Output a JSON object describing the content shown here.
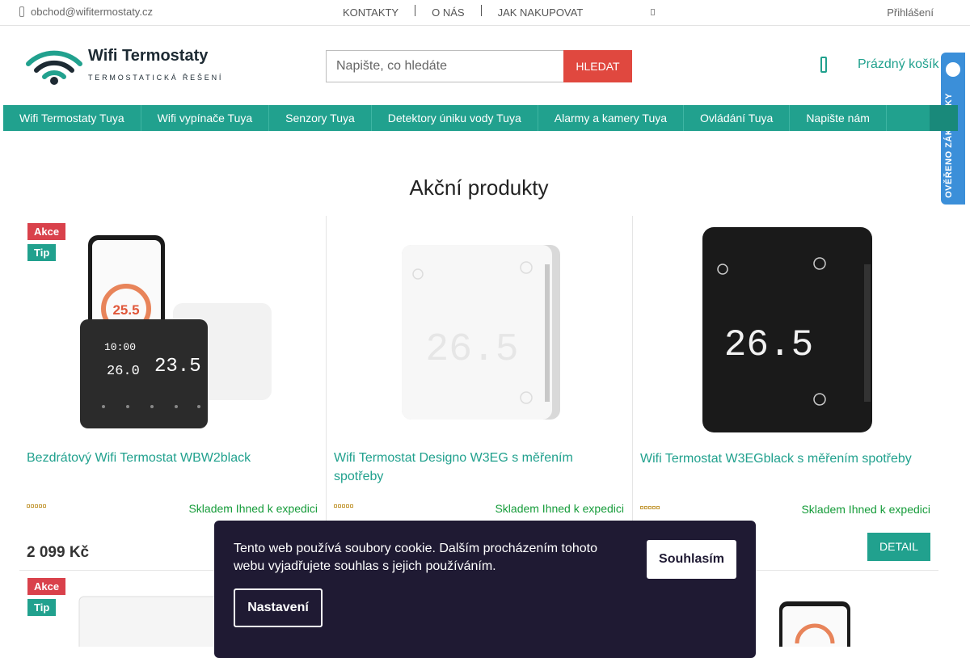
{
  "topbar": {
    "email": "obchod@wifitermostaty.cz",
    "links": [
      "KONTAKTY",
      "O NÁS",
      "JAK NAKUPOVAT"
    ],
    "login": "Přihlášení"
  },
  "logo": {
    "name": "Wifi Termostaty",
    "tagline": "TERMOSTATICKÁ ŘEŠENÍ"
  },
  "search": {
    "placeholder": "Napište, co hledáte",
    "button": "HLEDAT"
  },
  "cart": {
    "label": "Prázdný košík"
  },
  "nav": {
    "items": [
      "Wifi Termostaty Tuya",
      "Wifi vypínače Tuya",
      "Senzory Tuya",
      "Detektory úniku vody Tuya",
      "Alarmy a kamery Tuya",
      "Ovládání Tuya",
      "Napište nám"
    ]
  },
  "side_badge": {
    "text": "OVĚŘENO ZÁKAZNÍKY"
  },
  "section": {
    "title": "Akční produkty"
  },
  "products": [
    {
      "name": "Bezdrátový Wifi Termostat WBW2black",
      "stock": "Skladem Ihned k expedici",
      "price": "2 099 Kč",
      "flags": [
        "Akce",
        "Tip"
      ],
      "rating": 0
    },
    {
      "name": "Wifi Termostat Designo W3EG s měřením spotřeby",
      "stock": "Skladem Ihned k expedici",
      "flags": [],
      "rating": 0
    },
    {
      "name": "Wifi Termostat W3EGblack s měřením spotřeby",
      "stock": "Skladem Ihned k expedici",
      "detail": "DETAIL",
      "flags": [],
      "rating": 0
    }
  ],
  "products_row2": [
    {
      "flags": [
        "Akce",
        "Tip"
      ]
    }
  ],
  "screen_texts": {
    "p1_display_time": "10:00",
    "p1_display_temp": "26.0",
    "p1_display_room": "23.5",
    "p1_phone_temp": "25.5",
    "p2_display": "26.5",
    "p3_display": "26.5"
  },
  "cookie": {
    "text": "Tento web používá soubory cookie. Dalším procházením tohoto webu vyjadřujete souhlas s jejich používáním.",
    "accept": "Souhlasím",
    "settings": "Nastavení"
  },
  "colors": {
    "brand": "#21a18e",
    "accent_red": "#e0483f",
    "akce": "#d9414b",
    "stock_green": "#169c3a",
    "cookie_bg": "#1f1a33"
  }
}
